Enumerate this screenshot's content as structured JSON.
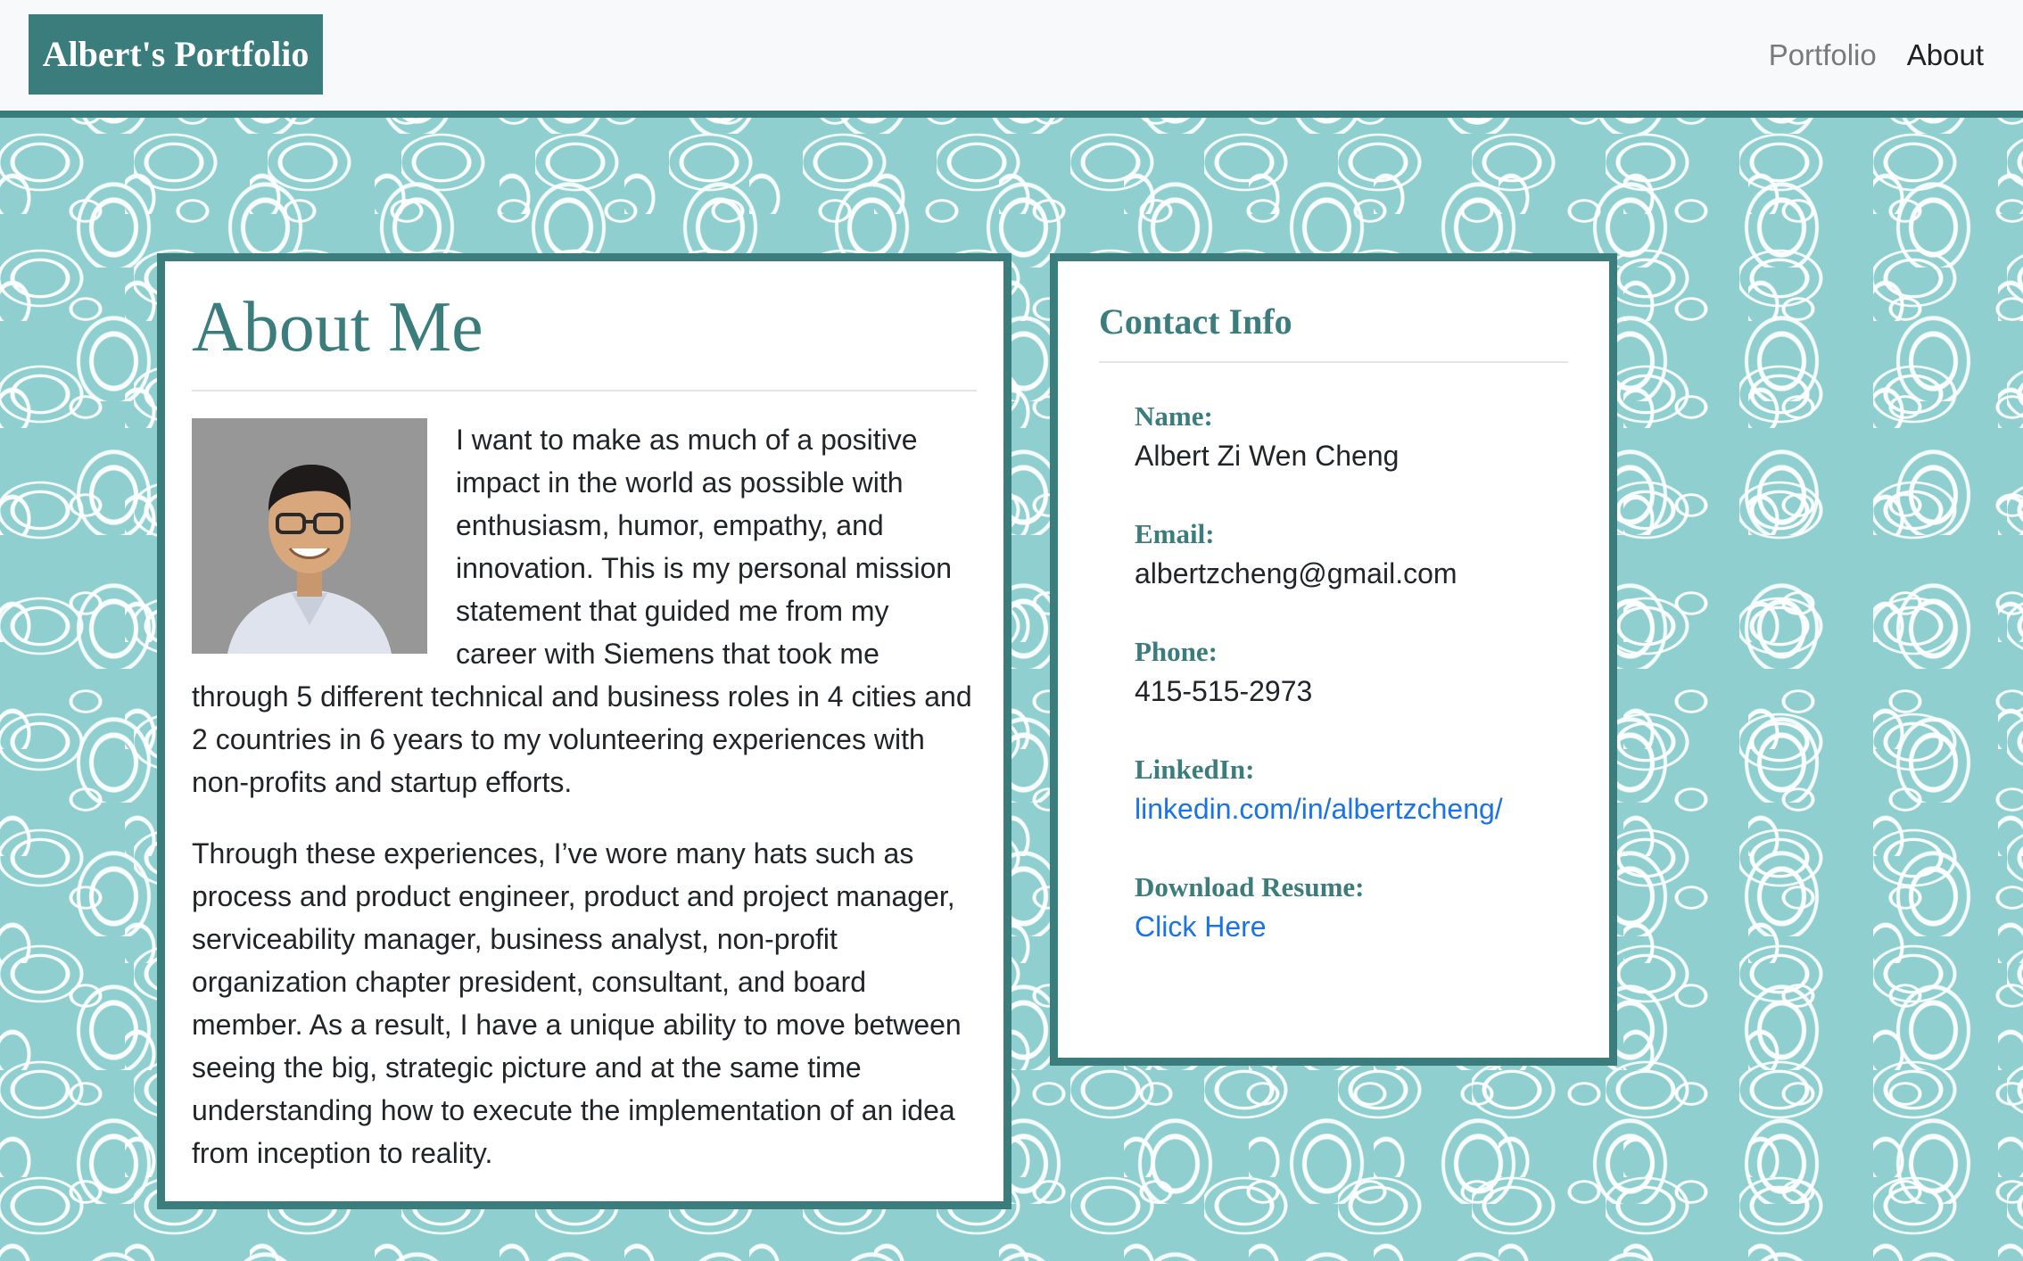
{
  "navbar": {
    "brand": "Albert's Portfolio",
    "links": [
      {
        "label": "Portfolio",
        "active": false
      },
      {
        "label": "About",
        "active": true
      }
    ]
  },
  "about": {
    "title": "About Me",
    "paragraphs": [
      "I want to make as much of a positive impact in the world as possible with enthusiasm, humor, empathy, and innovation. This is my personal mission statement that guided me from my career with Siemens that took me through 5 different technical and business roles in 4 cities and 2 countries in 6 years to my volunteering experiences with non-profits and startup efforts.",
      "Through these experiences, I’ve wore many hats such as process and product engineer, product and project manager, serviceability manager, business analyst, non-profit organization chapter president, consultant, and board member. As a result, I have a unique ability to move between seeing the big, strategic picture and at the same time understanding how to execute the implementation of an idea from inception to reality."
    ]
  },
  "contact": {
    "title": "Contact Info",
    "name_label": "Name:",
    "name_value": "Albert Zi Wen Cheng",
    "email_label": "Email:",
    "email_value": "albertzcheng@gmail.com",
    "phone_label": "Phone:",
    "phone_value": "415-515-2973",
    "linkedin_label": "LinkedIn:",
    "linkedin_value": "linkedin.com/in/albertzcheng/",
    "resume_label": "Download Resume:",
    "resume_link": "Click Here"
  },
  "colors": {
    "accent": "#3a7d7c",
    "link": "#1a73e8",
    "background_pattern": "#8fcfcf"
  }
}
